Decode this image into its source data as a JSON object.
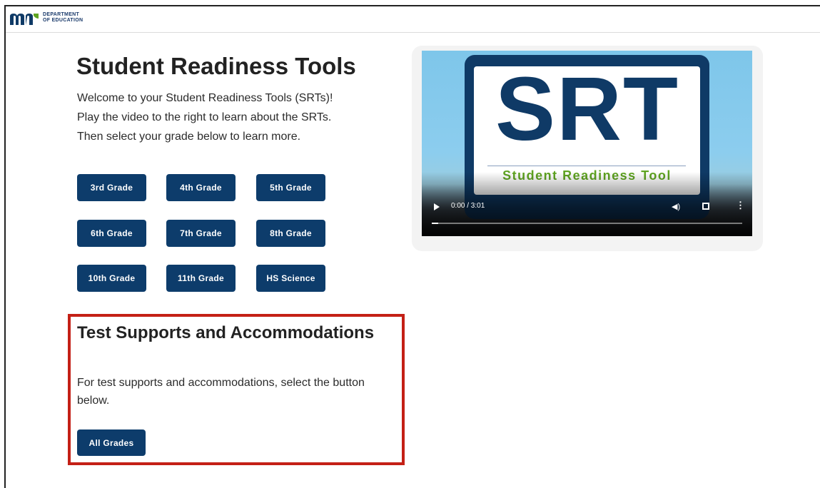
{
  "header": {
    "logo_text_line1": "DEPARTMENT",
    "logo_text_line2": "OF EDUCATION"
  },
  "main": {
    "title": "Student Readiness Tools",
    "intro": [
      "Welcome to your Student Readiness Tools (SRTs)!",
      "Play the video to the right to learn about the SRTs.",
      "Then select your grade below to learn more."
    ],
    "grades": [
      "3rd Grade",
      "4th Grade",
      "5th Grade",
      "6th Grade",
      "7th Grade",
      "8th Grade",
      "10th Grade",
      "11th Grade",
      "HS Science"
    ]
  },
  "supports": {
    "title": "Test Supports and Accommodations",
    "text": "For test supports and accommodations, select the button below.",
    "button": "All Grades"
  },
  "video": {
    "logo_big": "SRT",
    "logo_sub": "Student Readiness Tool",
    "time": "0:00 / 3:01",
    "progress": 0.02
  },
  "colors": {
    "button": "#0d3c6b",
    "highlight": "#c42016",
    "srt_blue": "#0f3a66",
    "srt_green": "#5fa421"
  }
}
